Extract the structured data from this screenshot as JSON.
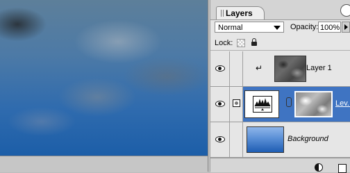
{
  "palette": {
    "tab_label": "Layers",
    "blend_mode": "Normal",
    "opacity_label": "Opacity:",
    "opacity_value": "100%",
    "lock_label": "Lock:"
  },
  "layers": [
    {
      "name": "Layer 1",
      "visible": true,
      "clipped": true,
      "clip_symbol": "↵"
    },
    {
      "name": "Lev...",
      "visible": true,
      "selected": true,
      "type": "levels-adjustment"
    },
    {
      "name": "Background",
      "visible": true
    }
  ],
  "icons": [
    "eye-icon",
    "lock-transparent-icon",
    "lock-all-icon",
    "chain-link-icon",
    "layer-style-icon",
    "new-layer-icon",
    "palette-menu-icon"
  ],
  "colors": {
    "selection": "#3f74c2",
    "canvas_sky": "#2f6bae"
  }
}
